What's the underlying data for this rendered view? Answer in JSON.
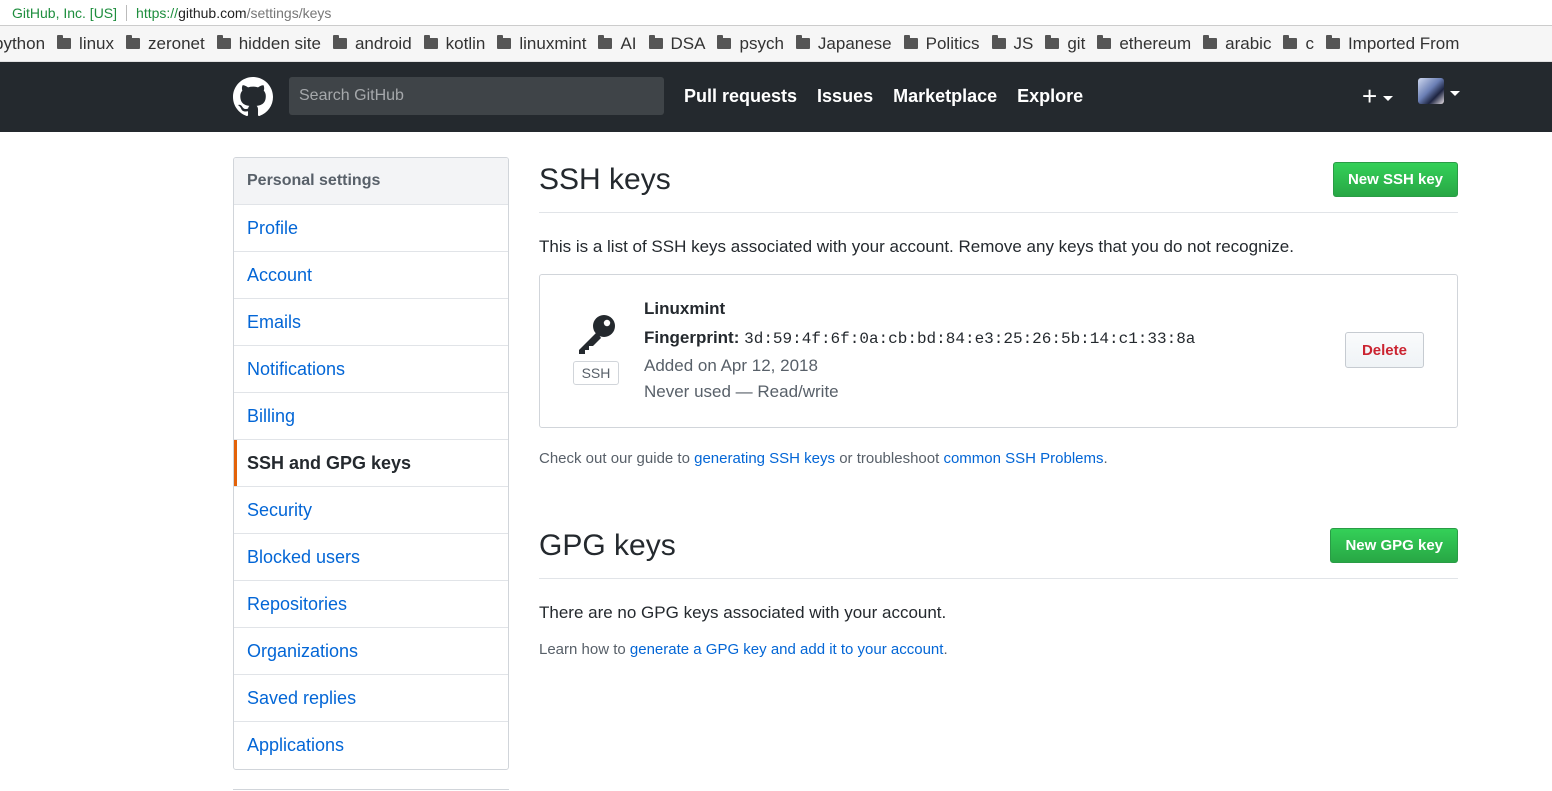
{
  "browser": {
    "org": "GitHub, Inc. [US]",
    "url_protocol": "https://",
    "url_host": "github.com",
    "url_path": "/settings/keys"
  },
  "bookmarks": [
    {
      "label": "python",
      "folder": false
    },
    {
      "label": "linux",
      "folder": true
    },
    {
      "label": "zeronet",
      "folder": true
    },
    {
      "label": "hidden site",
      "folder": true
    },
    {
      "label": "android",
      "folder": true
    },
    {
      "label": "kotlin",
      "folder": true
    },
    {
      "label": "linuxmint",
      "folder": true
    },
    {
      "label": "AI",
      "folder": true
    },
    {
      "label": "DSA",
      "folder": true
    },
    {
      "label": "psych",
      "folder": true
    },
    {
      "label": "Japanese",
      "folder": true
    },
    {
      "label": "Politics",
      "folder": true
    },
    {
      "label": "JS",
      "folder": true
    },
    {
      "label": "git",
      "folder": true
    },
    {
      "label": "ethereum",
      "folder": true
    },
    {
      "label": "arabic",
      "folder": true
    },
    {
      "label": "c",
      "folder": true
    },
    {
      "label": "Imported From",
      "folder": true
    }
  ],
  "header": {
    "search_placeholder": "Search GitHub",
    "nav": [
      "Pull requests",
      "Issues",
      "Marketplace",
      "Explore"
    ],
    "plus_label": "+"
  },
  "sidebar": {
    "title": "Personal settings",
    "items": [
      {
        "label": "Profile",
        "selected": false
      },
      {
        "label": "Account",
        "selected": false
      },
      {
        "label": "Emails",
        "selected": false
      },
      {
        "label": "Notifications",
        "selected": false
      },
      {
        "label": "Billing",
        "selected": false
      },
      {
        "label": "SSH and GPG keys",
        "selected": true
      },
      {
        "label": "Security",
        "selected": false
      },
      {
        "label": "Blocked users",
        "selected": false
      },
      {
        "label": "Repositories",
        "selected": false
      },
      {
        "label": "Organizations",
        "selected": false
      },
      {
        "label": "Saved replies",
        "selected": false
      },
      {
        "label": "Applications",
        "selected": false
      }
    ]
  },
  "ssh": {
    "title": "SSH keys",
    "new_button": "New SSH key",
    "intro": "This is a list of SSH keys associated with your account. Remove any keys that you do not recognize.",
    "key": {
      "badge": "SSH",
      "name": "Linuxmint",
      "fingerprint_label": "Fingerprint:",
      "fingerprint": "3d:59:4f:6f:0a:cb:bd:84:e3:25:26:5b:14:c1:33:8a",
      "added": "Added on Apr 12, 2018",
      "usage": "Never used — Read/write",
      "delete_button": "Delete"
    },
    "guide_prefix": "Check out our guide to ",
    "guide_link1": "generating SSH keys",
    "guide_middle": " or troubleshoot ",
    "guide_link2": "common SSH Problems",
    "guide_suffix": "."
  },
  "gpg": {
    "title": "GPG keys",
    "new_button": "New GPG key",
    "none": "There are no GPG keys associated with your account.",
    "learn_prefix": "Learn how to ",
    "learn_link": "generate a GPG key and add it to your account",
    "learn_suffix": "."
  },
  "colors": {
    "header_bg": "#24292e",
    "link": "#0366d6",
    "primary_button": "#28a745",
    "danger_text": "#cb2431",
    "selected_accent": "#e36209"
  }
}
